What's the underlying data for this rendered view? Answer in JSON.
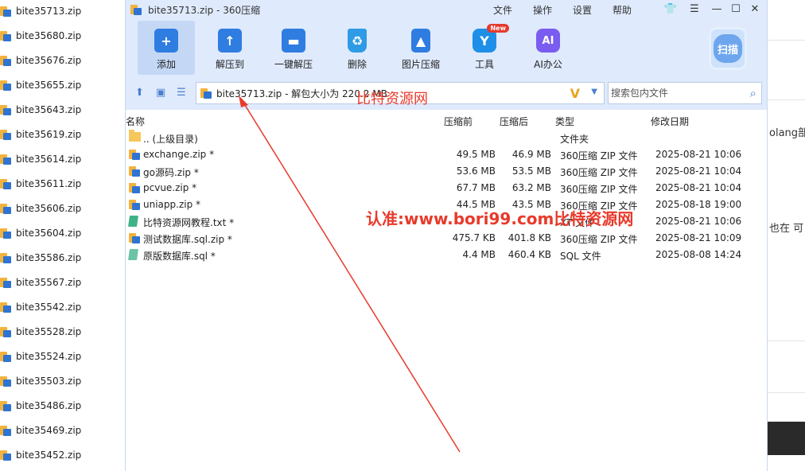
{
  "desktop_files": [
    "bite35713.zip",
    "bite35680.zip",
    "bite35676.zip",
    "bite35655.zip",
    "bite35643.zip",
    "bite35619.zip",
    "bite35614.zip",
    "bite35611.zip",
    "bite35606.zip",
    "bite35604.zip",
    "bite35586.zip",
    "bite35567.zip",
    "bite35542.zip",
    "bite35528.zip",
    "bite35524.zip",
    "bite35503.zip",
    "bite35486.zip",
    "bite35469.zip",
    "bite35452.zip"
  ],
  "right_pane": {
    "text1": "olang部",
    "text2": "也在 可"
  },
  "window": {
    "title": "bite35713.zip - 360压缩",
    "menus": [
      "文件",
      "操作",
      "设置",
      "帮助"
    ],
    "controls": {
      "skin": "👕",
      "menu": "☰",
      "minimize": "—",
      "maximize": "☐",
      "close": "✕"
    }
  },
  "toolbar": {
    "buttons": [
      {
        "label": "添加",
        "icon": "add-icon",
        "color": "#2f7de1"
      },
      {
        "label": "解压到",
        "icon": "extract-to-icon",
        "color": "#2f7de1"
      },
      {
        "label": "一键解压",
        "icon": "one-click-extract-icon",
        "color": "#2f7de1"
      },
      {
        "label": "删除",
        "icon": "delete-icon",
        "color": "#2f9be6"
      },
      {
        "label": "图片压缩",
        "icon": "image-compress-icon",
        "color": "#2f7de1"
      },
      {
        "label": "工具",
        "icon": "tools-icon",
        "color": "#1e8fe8"
      },
      {
        "label": "AI办公",
        "icon": "ai-office-icon",
        "color": "#7a5cf0"
      }
    ],
    "tools_badge": "New",
    "ai_glyph": "AI",
    "scan_label": "扫描"
  },
  "address": {
    "path": "bite35713.zip - 解包大小为 220.2 MB",
    "search_placeholder": "搜索包内文件"
  },
  "columns": {
    "name": "名称",
    "before": "压缩前",
    "after": "压缩后",
    "type": "类型",
    "date": "修改日期"
  },
  "files": [
    {
      "name": ".. (上级目录)",
      "before": "",
      "after": "",
      "type": "文件夹",
      "date": "",
      "icon": "folder-icon"
    },
    {
      "name": "exchange.zip *",
      "before": "49.5 MB",
      "after": "46.9 MB",
      "type": "360压缩 ZIP 文件",
      "date": "2025-08-21 10:06",
      "icon": "zip-icon"
    },
    {
      "name": "go源码.zip *",
      "before": "53.6 MB",
      "after": "53.5 MB",
      "type": "360压缩 ZIP 文件",
      "date": "2025-08-21 10:04",
      "icon": "zip-icon"
    },
    {
      "name": "pcvue.zip *",
      "before": "67.7 MB",
      "after": "63.2 MB",
      "type": "360压缩 ZIP 文件",
      "date": "2025-08-21 10:04",
      "icon": "zip-icon"
    },
    {
      "name": "uniapp.zip *",
      "before": "44.5 MB",
      "after": "43.5 MB",
      "type": "360压缩 ZIP 文件",
      "date": "2025-08-18 19:00",
      "icon": "zip-icon"
    },
    {
      "name": "比特资源网教程.txt *",
      "before": "",
      "after": "",
      "type": "XT 文件",
      "date": "2025-08-21 10:06",
      "icon": "txt-icon"
    },
    {
      "name": "测试数据库.sql.zip *",
      "before": "475.7 KB",
      "after": "401.8 KB",
      "type": "360压缩 ZIP 文件",
      "date": "2025-08-21 10:09",
      "icon": "zip-icon"
    },
    {
      "name": "原版数据库.sql *",
      "before": "4.4 MB",
      "after": "460.4 KB",
      "type": "SQL 文件",
      "date": "2025-08-08 14:24",
      "icon": "sql-icon"
    }
  ],
  "watermarks": {
    "small": "比特资源网",
    "large": "认准:www.bori99.com比特资源网"
  }
}
